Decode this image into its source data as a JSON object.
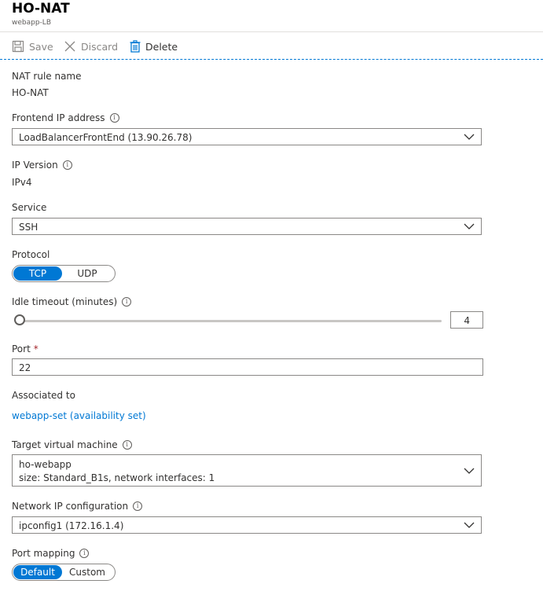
{
  "header": {
    "title": "HO-NAT",
    "subtitle": "webapp-LB"
  },
  "toolbar": {
    "save": "Save",
    "discard": "Discard",
    "delete": "Delete"
  },
  "form": {
    "nat_rule_name": {
      "label": "NAT rule name",
      "value": "HO-NAT"
    },
    "frontend_ip": {
      "label": "Frontend IP address",
      "value": "LoadBalancerFrontEnd (13.90.26.78)"
    },
    "ip_version": {
      "label": "IP Version",
      "value": "IPv4"
    },
    "service": {
      "label": "Service",
      "value": "SSH"
    },
    "protocol": {
      "label": "Protocol",
      "options": [
        "TCP",
        "UDP"
      ],
      "selected": "TCP"
    },
    "idle_timeout": {
      "label": "Idle timeout (minutes)",
      "value": "4"
    },
    "port": {
      "label": "Port",
      "required_marker": "*",
      "value": "22"
    },
    "associated_to": {
      "label": "Associated to",
      "link": "webapp-set (availability set)"
    },
    "target_vm": {
      "label": "Target virtual machine",
      "name": "ho-webapp",
      "detail": "size: Standard_B1s, network interfaces: 1"
    },
    "network_ip_config": {
      "label": "Network IP configuration",
      "value": "ipconfig1 (172.16.1.4)"
    },
    "port_mapping": {
      "label": "Port mapping",
      "options": [
        "Default",
        "Custom"
      ],
      "selected": "Default"
    }
  },
  "colors": {
    "accent": "#0078d4",
    "border": "#8a8886",
    "text": "#323130"
  }
}
